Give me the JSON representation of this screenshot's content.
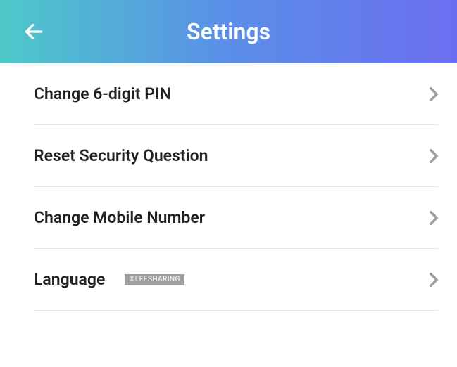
{
  "header": {
    "title": "Settings"
  },
  "items": [
    {
      "label": "Change 6-digit PIN"
    },
    {
      "label": "Reset Security Question"
    },
    {
      "label": "Change Mobile Number"
    },
    {
      "label": "Language"
    }
  ],
  "watermark": "©LEESHARING"
}
